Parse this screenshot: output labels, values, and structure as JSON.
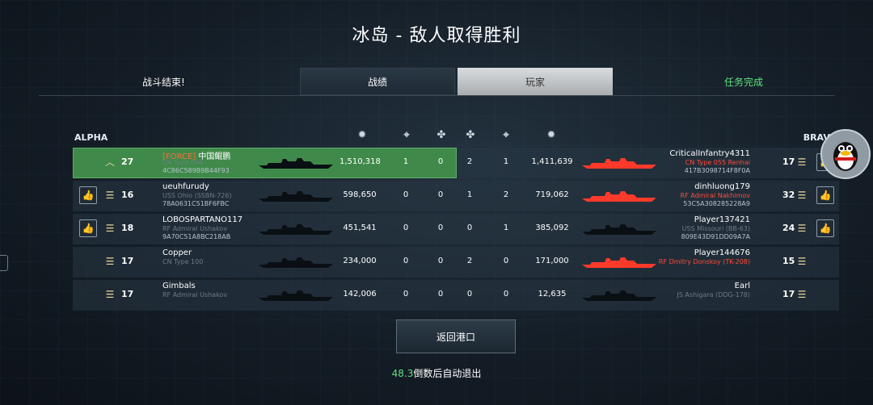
{
  "title": "冰岛 - 敌人取得胜利",
  "status_left": "战斗结束!",
  "status_right": "任务完成",
  "tabs": [
    {
      "label": "战绩",
      "active": true
    },
    {
      "label": "玩家",
      "active": false
    }
  ],
  "teams": {
    "alpha": "ALPHA",
    "bravo": "BRAVO"
  },
  "stat_columns": [
    "damage-icon",
    "kills-icon",
    "assists-icon",
    "assists-icon",
    "kills-icon",
    "damage-icon"
  ],
  "colors": {
    "highlight": "#3f8a4a",
    "enemy_ship": "#ff3a2a",
    "accent_green": "#5fe07c",
    "clan_tag": "#ff6b3b"
  },
  "rows": [
    {
      "left": {
        "thumb": false,
        "rank_icon": "chevron-rank-icon",
        "level": "27",
        "clan": "[FORCE]",
        "name": " 中国鲲鹏",
        "ship": "CN Type 004",
        "id": "4C86C589B9B44F93",
        "damage": "1,510,318",
        "kills": "1",
        "assists": "0"
      },
      "right": {
        "name": "CriticalInfantry4311",
        "ship": "CN Type 055 Renhai",
        "ship_red": true,
        "id": "417B3098714F8F0A",
        "damage": "1,411,639",
        "kills": "1",
        "assists": "2",
        "level": "17",
        "thumb": true,
        "enemy_red": true
      },
      "highlight": true
    },
    {
      "left": {
        "thumb": true,
        "rank_icon": "bars-rank-icon",
        "level": "16",
        "clan": "",
        "name": "ueuhfurudy",
        "ship": "USS Ohio (SSBN-726)",
        "id": "78A0631C51BF6FBC",
        "damage": "598,650",
        "kills": "0",
        "assists": "0"
      },
      "right": {
        "name": "dinhluong179",
        "ship": "RF Admiral Nakhimov",
        "ship_red": true,
        "id": "53C5A308285228A9",
        "damage": "719,062",
        "kills": "2",
        "assists": "1",
        "level": "32",
        "thumb": true,
        "enemy_red": true
      },
      "highlight": false
    },
    {
      "left": {
        "thumb": true,
        "rank_icon": "bars-rank-icon",
        "level": "18",
        "clan": "",
        "name": "LOBOSPARTANO117",
        "ship": "RF Admiral Ushakov",
        "id": "9A70C51A8BC218AB",
        "damage": "451,541",
        "kills": "0",
        "assists": "0"
      },
      "right": {
        "name": "Player137421",
        "ship": "USS Missouri (BB-63)",
        "ship_red": false,
        "id": "809E43D91DD09A7A",
        "damage": "385,092",
        "kills": "1",
        "assists": "0",
        "level": "24",
        "thumb": true,
        "enemy_red": false
      },
      "highlight": false
    },
    {
      "left": {
        "thumb": false,
        "rank_icon": "bars-rank-icon",
        "level": "17",
        "clan": "",
        "name": "Copper",
        "ship": "CN Type 100",
        "id": "",
        "damage": "234,000",
        "kills": "0",
        "assists": "0"
      },
      "right": {
        "name": "Player144676",
        "ship": "RF Dmitry Donskoy (TK-208)",
        "ship_red": true,
        "id": "",
        "damage": "171,000",
        "kills": "0",
        "assists": "2",
        "level": "15",
        "thumb": false,
        "enemy_red": true
      },
      "highlight": false
    },
    {
      "left": {
        "thumb": false,
        "rank_icon": "bars-rank-icon",
        "level": "17",
        "clan": "",
        "name": "Gimbals",
        "ship": "RF Admiral Ushakov",
        "id": "",
        "damage": "142,006",
        "kills": "0",
        "assists": "0"
      },
      "right": {
        "name": "Earl",
        "ship": "JS Ashigara (DDG-178)",
        "ship_red": false,
        "id": "",
        "damage": "12,635",
        "kills": "0",
        "assists": "0",
        "level": "17",
        "thumb": false,
        "enemy_red": false
      },
      "highlight": false
    }
  ],
  "back_button": "返回港口",
  "countdown": {
    "seconds": "48.3",
    "text": "倒数后自动退出"
  }
}
